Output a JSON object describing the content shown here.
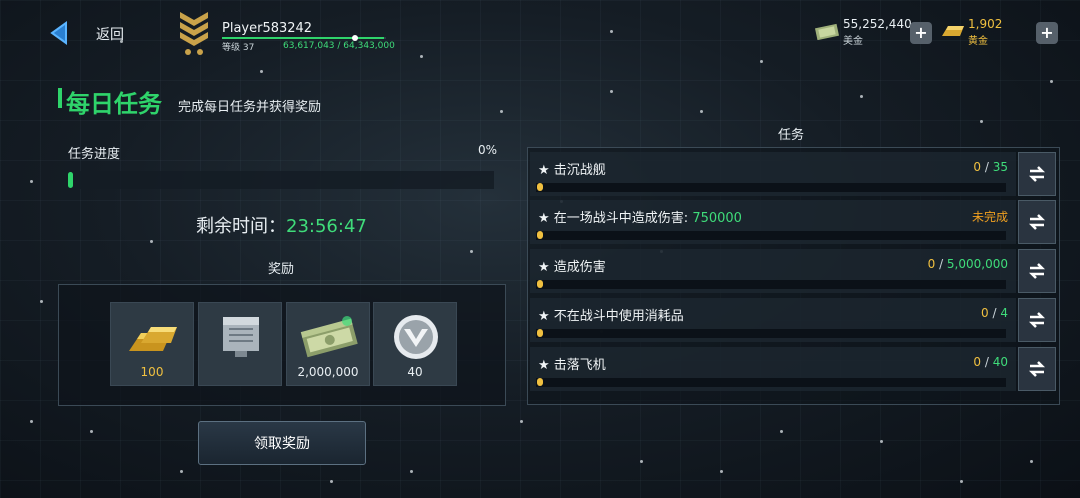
{
  "header": {
    "back_label": "返回",
    "player_name": "Player583242",
    "level_label": "等级 37",
    "xp_text": "63,617,043 / 64,343,000",
    "xp_progress": 0.989,
    "cash_value": "55,252,440",
    "cash_label": "美金",
    "gold_value": "1,902",
    "gold_label": "黄金",
    "plus_glyph": "+"
  },
  "daily": {
    "title": "每日任务",
    "subtitle": "完成每日任务并获得奖励",
    "progress_label": "任务进度",
    "progress_pct": "0%",
    "remain_label": "剩余时间：",
    "remain_time": "23:56:47",
    "reward_heading": "奖励",
    "claim_label": "领取奖励"
  },
  "rewards": [
    {
      "icon": "gold-bars-icon",
      "value": "100"
    },
    {
      "icon": "equipment-module-icon",
      "value": ""
    },
    {
      "icon": "cash-stack-icon",
      "value": "2,000,000"
    },
    {
      "icon": "silver-emblem-icon",
      "value": "40"
    }
  ],
  "tasks_heading": "任务",
  "tasks": [
    {
      "name": "击沉战舰",
      "highlight": "",
      "current": "0",
      "total": "35",
      "status": ""
    },
    {
      "name": "在一场战斗中造成伤害: ",
      "highlight": "750000",
      "current": "",
      "total": "",
      "status": "未完成"
    },
    {
      "name": "造成伤害",
      "highlight": "",
      "current": "0",
      "total": "5,000,000",
      "status": ""
    },
    {
      "name": "不在战斗中使用消耗品",
      "highlight": "",
      "current": "0",
      "total": "4",
      "status": ""
    },
    {
      "name": "击落飞机",
      "highlight": "",
      "current": "0",
      "total": "40",
      "status": ""
    }
  ],
  "colors": {
    "accent_green": "#2fd46b",
    "gold": "#f0c040",
    "incomplete": "#f0a020"
  }
}
